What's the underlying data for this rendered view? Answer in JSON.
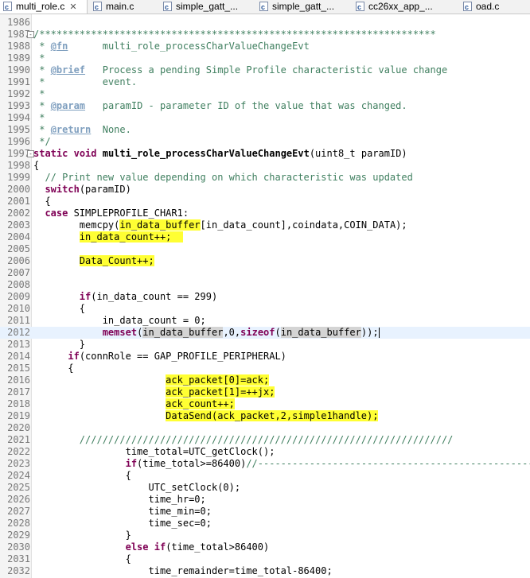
{
  "tabs": [
    {
      "label": "multi_role.c",
      "active": true,
      "close": "✕"
    },
    {
      "label": "main.c",
      "active": false
    },
    {
      "label": "simple_gatt_...",
      "active": false
    },
    {
      "label": "simple_gatt_...",
      "active": false
    },
    {
      "label": "cc26xx_app_...",
      "active": false
    },
    {
      "label": "oad.c",
      "active": false
    }
  ],
  "lines": [
    {
      "n": "1986",
      "segs": [
        {
          "t": ""
        }
      ]
    },
    {
      "n": "1987",
      "fold": "-",
      "segs": [
        {
          "t": "/*********************************************************************",
          "c": "cm"
        }
      ]
    },
    {
      "n": "1988",
      "segs": [
        {
          "t": " * ",
          "c": "cm"
        },
        {
          "t": "@fn",
          "c": "tag"
        },
        {
          "t": "      multi_role_processCharValueChangeEvt",
          "c": "cm"
        }
      ]
    },
    {
      "n": "1989",
      "segs": [
        {
          "t": " *",
          "c": "cm"
        }
      ]
    },
    {
      "n": "1990",
      "segs": [
        {
          "t": " * ",
          "c": "cm"
        },
        {
          "t": "@brief",
          "c": "tag"
        },
        {
          "t": "   Process a pending Simple Profile characteristic value change",
          "c": "cm"
        }
      ]
    },
    {
      "n": "1991",
      "segs": [
        {
          "t": " *          event.",
          "c": "cm"
        }
      ]
    },
    {
      "n": "1992",
      "segs": [
        {
          "t": " *",
          "c": "cm"
        }
      ]
    },
    {
      "n": "1993",
      "segs": [
        {
          "t": " * ",
          "c": "cm"
        },
        {
          "t": "@param",
          "c": "tag"
        },
        {
          "t": "   paramID - parameter ID of the value that was changed.",
          "c": "cm"
        }
      ]
    },
    {
      "n": "1994",
      "segs": [
        {
          "t": " *",
          "c": "cm"
        }
      ]
    },
    {
      "n": "1995",
      "segs": [
        {
          "t": " * ",
          "c": "cm"
        },
        {
          "t": "@return",
          "c": "tag"
        },
        {
          "t": "  None.",
          "c": "cm"
        }
      ]
    },
    {
      "n": "1996",
      "segs": [
        {
          "t": " */",
          "c": "cm"
        }
      ]
    },
    {
      "n": "1997",
      "fold": "-",
      "segs": [
        {
          "t": "static",
          "c": "kw"
        },
        {
          "t": " "
        },
        {
          "t": "void",
          "c": "kw"
        },
        {
          "t": " "
        },
        {
          "t": "multi_role_processCharValueChangeEvt",
          "c": "fn"
        },
        {
          "t": "(uint8_t paramID)"
        }
      ]
    },
    {
      "n": "1998",
      "segs": [
        {
          "t": "{"
        }
      ]
    },
    {
      "n": "1999",
      "segs": [
        {
          "t": "  "
        },
        {
          "t": "// Print new value depending on which characteristic was updated",
          "c": "cm"
        }
      ]
    },
    {
      "n": "2000",
      "segs": [
        {
          "t": "  "
        },
        {
          "t": "switch",
          "c": "kw"
        },
        {
          "t": "(paramID)"
        }
      ]
    },
    {
      "n": "2001",
      "segs": [
        {
          "t": "  {"
        }
      ]
    },
    {
      "n": "2002",
      "segs": [
        {
          "t": "  "
        },
        {
          "t": "case",
          "c": "kw"
        },
        {
          "t": " SIMPLEPROFILE_CHAR1:"
        }
      ]
    },
    {
      "n": "2003",
      "segs": [
        {
          "t": "        memcpy("
        },
        {
          "t": "in_data_buffer",
          "c": "hl"
        },
        {
          "t": "[in_data_count],coindata,COIN_DATA);"
        }
      ]
    },
    {
      "n": "2004",
      "segs": [
        {
          "t": "        "
        },
        {
          "t": "in_data_count++;  ",
          "c": "hl"
        }
      ]
    },
    {
      "n": "2005",
      "segs": [
        {
          "t": ""
        }
      ]
    },
    {
      "n": "2006",
      "segs": [
        {
          "t": "        "
        },
        {
          "t": "Data_Count++;",
          "c": "hl"
        }
      ]
    },
    {
      "n": "2007",
      "segs": [
        {
          "t": ""
        }
      ]
    },
    {
      "n": "2008",
      "segs": [
        {
          "t": ""
        }
      ]
    },
    {
      "n": "2009",
      "segs": [
        {
          "t": "        "
        },
        {
          "t": "if",
          "c": "kw"
        },
        {
          "t": "(in_data_count == 299)"
        }
      ]
    },
    {
      "n": "2010",
      "segs": [
        {
          "t": "        {"
        }
      ]
    },
    {
      "n": "2011",
      "segs": [
        {
          "t": "            in_data_count = 0;"
        }
      ]
    },
    {
      "n": "2012",
      "current": true,
      "segs": [
        {
          "t": "            "
        },
        {
          "t": "memset",
          "c": "kw"
        },
        {
          "t": "("
        },
        {
          "t": "in_data_buffer",
          "c": "occ"
        },
        {
          "t": ",0,"
        },
        {
          "t": "sizeof",
          "c": "kw"
        },
        {
          "t": "("
        },
        {
          "t": "in_data_buffer",
          "c": "occ"
        },
        {
          "t": "));"
        },
        {
          "cursor": true
        }
      ]
    },
    {
      "n": "2013",
      "segs": [
        {
          "t": "        }"
        }
      ]
    },
    {
      "n": "2014",
      "segs": [
        {
          "t": "      "
        },
        {
          "t": "if",
          "c": "kw"
        },
        {
          "t": "(connRole == GAP_PROFILE_PERIPHERAL)"
        }
      ]
    },
    {
      "n": "2015",
      "segs": [
        {
          "t": "      {"
        }
      ]
    },
    {
      "n": "2016",
      "segs": [
        {
          "t": "                       "
        },
        {
          "t": "ack_packet[0]=ack;",
          "c": "hl"
        }
      ]
    },
    {
      "n": "2017",
      "segs": [
        {
          "t": "                       "
        },
        {
          "t": "ack_packet[1]=++jx;",
          "c": "hl"
        }
      ]
    },
    {
      "n": "2018",
      "segs": [
        {
          "t": "                       "
        },
        {
          "t": "ack_count++;",
          "c": "hl"
        }
      ]
    },
    {
      "n": "2019",
      "segs": [
        {
          "t": "                       "
        },
        {
          "t": "DataSend(ack_packet,2,simple1handle);",
          "c": "hl"
        }
      ]
    },
    {
      "n": "2020",
      "segs": [
        {
          "t": ""
        }
      ]
    },
    {
      "n": "2021",
      "segs": [
        {
          "t": "        "
        },
        {
          "t": "/////////////////////////////////////////////////////////////////",
          "c": "cm"
        }
      ]
    },
    {
      "n": "2022",
      "segs": [
        {
          "t": "                time_total=UTC_getClock();"
        }
      ]
    },
    {
      "n": "2023",
      "segs": [
        {
          "t": "                "
        },
        {
          "t": "if",
          "c": "kw"
        },
        {
          "t": "(time_total>=86400)"
        },
        {
          "t": "//---------------------------------------------------------",
          "c": "cm"
        }
      ]
    },
    {
      "n": "2024",
      "segs": [
        {
          "t": "                {"
        }
      ]
    },
    {
      "n": "2025",
      "segs": [
        {
          "t": "                    UTC_setClock(0);"
        }
      ]
    },
    {
      "n": "2026",
      "segs": [
        {
          "t": "                    time_hr=0;"
        }
      ]
    },
    {
      "n": "2027",
      "segs": [
        {
          "t": "                    time_min=0;"
        }
      ]
    },
    {
      "n": "2028",
      "segs": [
        {
          "t": "                    time_sec=0;"
        }
      ]
    },
    {
      "n": "2029",
      "segs": [
        {
          "t": "                }"
        }
      ]
    },
    {
      "n": "2030",
      "segs": [
        {
          "t": "                "
        },
        {
          "t": "else",
          "c": "kw"
        },
        {
          "t": " "
        },
        {
          "t": "if",
          "c": "kw"
        },
        {
          "t": "(time_total>86400)"
        }
      ]
    },
    {
      "n": "2031",
      "segs": [
        {
          "t": "                {"
        }
      ]
    },
    {
      "n": "2032",
      "segs": [
        {
          "t": "                    time_remainder=time_total-86400;"
        }
      ]
    }
  ]
}
